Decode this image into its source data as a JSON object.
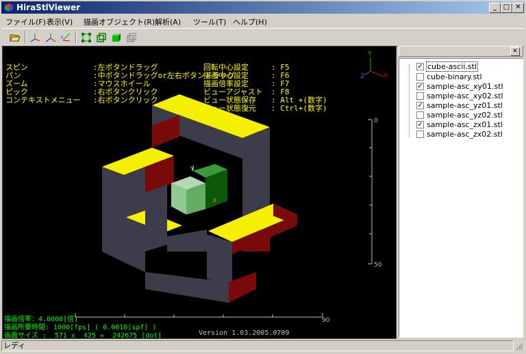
{
  "window": {
    "title": "HiraStlViewer",
    "min": "_",
    "max": "□",
    "close": "✕"
  },
  "menu": [
    "ファイル(F)",
    "表示(V)",
    "描画オブジェクト(R)",
    "解析(A)",
    "ツール(T)",
    "ヘルプ(H)"
  ],
  "toolbar": {
    "icons": [
      "open-folder-icon",
      "axis-xyz-icon",
      "axis-xy-icon",
      "axis-zx-icon",
      "wireframe-icon",
      "cube-outline-icon",
      "solid-cube-icon",
      "hidden-cube-icon"
    ]
  },
  "help": {
    "left_keys": [
      "スピン",
      "パン",
      "ズーム",
      "ピック",
      "コンテキストメニュー"
    ],
    "left_vals": [
      ":左ボタンドラッグ",
      ":中ボタンドラッグor左右ボタンドラッグ",
      ":マウスホイール",
      ":右ボタンクリック",
      ":右ボタンクリック"
    ],
    "right_keys": [
      "回転中心設定",
      "描画中心設定",
      "描画倍率設定",
      "ビューアジャスト",
      "ビュー状態保存",
      "ビュー状態復元"
    ],
    "right_vals": [
      ": F5",
      ": F6",
      ": F7",
      ": F8",
      ": Alt +(数字)",
      ": Ctrl+(数字)"
    ]
  },
  "axis_labels": {
    "y": "Y",
    "x": "X",
    "z": "Z",
    "cube_y": "Y",
    "cube_x": "X"
  },
  "scale_v": {
    "top": "0",
    "bottom": "50"
  },
  "scale_h": {
    "right": "90"
  },
  "info": {
    "line1": "描画倍率：4.0000[倍]",
    "line2": "描画所要時間: 1000[fps] ( 0.0010[spf] )",
    "line3": "画面サイズ :  571 x  425 =  242675 [dot]",
    "version": "Version 1.03.2005.0709"
  },
  "panel": {
    "close": "✕"
  },
  "files": [
    {
      "name": "cube-ascii.stl",
      "checked": true,
      "selected": true
    },
    {
      "name": "cube-binary.stl",
      "checked": false,
      "selected": false
    },
    {
      "name": "sample-asc_xy01.stl",
      "checked": true,
      "selected": false
    },
    {
      "name": "sample-asc_xy02.stl",
      "checked": false,
      "selected": false
    },
    {
      "name": "sample-asc_yz01.stl",
      "checked": true,
      "selected": false
    },
    {
      "name": "sample-asc_yz02.stl",
      "checked": false,
      "selected": false
    },
    {
      "name": "sample-asc_zx01.stl",
      "checked": true,
      "selected": false
    },
    {
      "name": "sample-asc_zx02.stl",
      "checked": false,
      "selected": false
    }
  ],
  "status": "レディ",
  "colors": {
    "titlebar": "#0a246a",
    "help_text": "#ffff00",
    "info_text": "#00ff00",
    "shape_yellow": "#f5f000",
    "shape_red": "#7a0a0a",
    "shape_dark": "#3c3c4a"
  }
}
